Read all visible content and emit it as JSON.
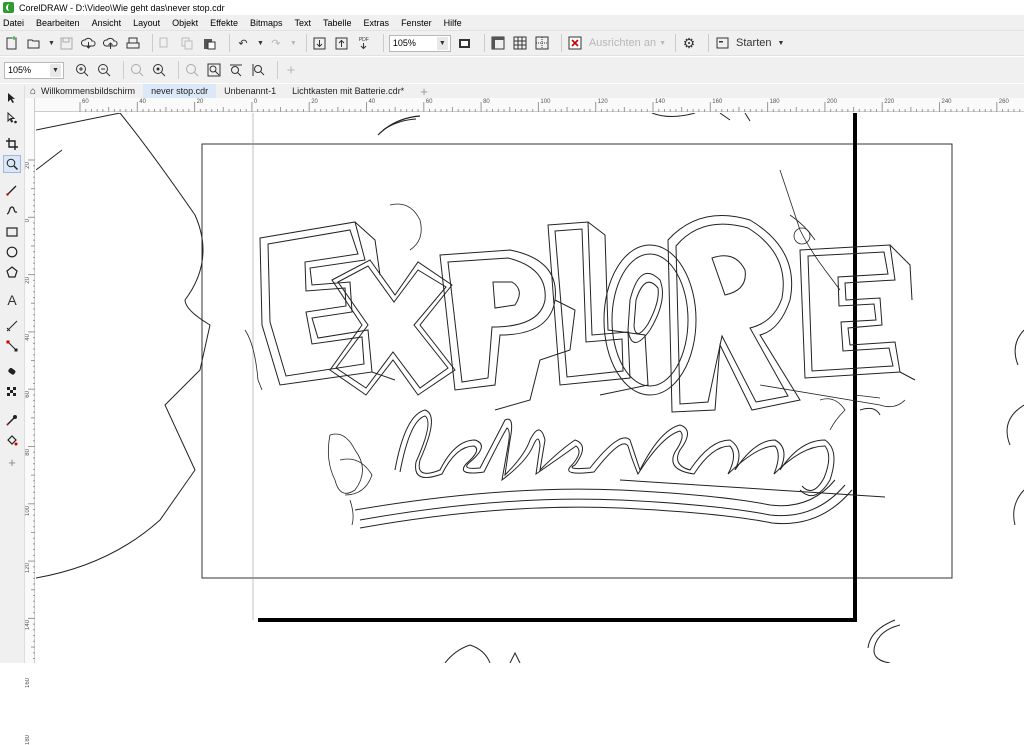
{
  "window": {
    "title": "CorelDRAW - D:\\Video\\Wie geht das\\never stop.cdr"
  },
  "menu": [
    {
      "label": "Datei"
    },
    {
      "label": "Bearbeiten"
    },
    {
      "label": "Ansicht"
    },
    {
      "label": "Layout"
    },
    {
      "label": "Objekt"
    },
    {
      "label": "Effekte"
    },
    {
      "label": "Bitmaps"
    },
    {
      "label": "Text"
    },
    {
      "label": "Tabelle"
    },
    {
      "label": "Extras"
    },
    {
      "label": "Fenster"
    },
    {
      "label": "Hilfe"
    }
  ],
  "toolbar": {
    "zoom_value": "105%",
    "align_label": "Ausrichten an",
    "start_label": "Starten",
    "pdf_label": "PDF"
  },
  "property_bar": {
    "zoom_value": "105%"
  },
  "tabs": [
    {
      "label": "Willkommensbildschirm"
    },
    {
      "label": "never stop.cdr"
    },
    {
      "label": "Unbenannt-1"
    },
    {
      "label": "Lichtkasten mit Batterie.cdr*"
    }
  ],
  "ruler": {
    "h_labels": [
      "60",
      "40",
      "20",
      "0",
      "20",
      "40",
      "60",
      "80",
      "100",
      "120",
      "140",
      "160",
      "180",
      "200",
      "220",
      "240",
      "260"
    ],
    "v_labels": [
      "20",
      "0",
      "20",
      "40",
      "60",
      "80",
      "100",
      "120",
      "140",
      "160",
      "180"
    ]
  },
  "colors": {
    "chrome": "#f0f0f0",
    "active_tab": "#dbe8f7",
    "logo": "#2e9b2f"
  }
}
